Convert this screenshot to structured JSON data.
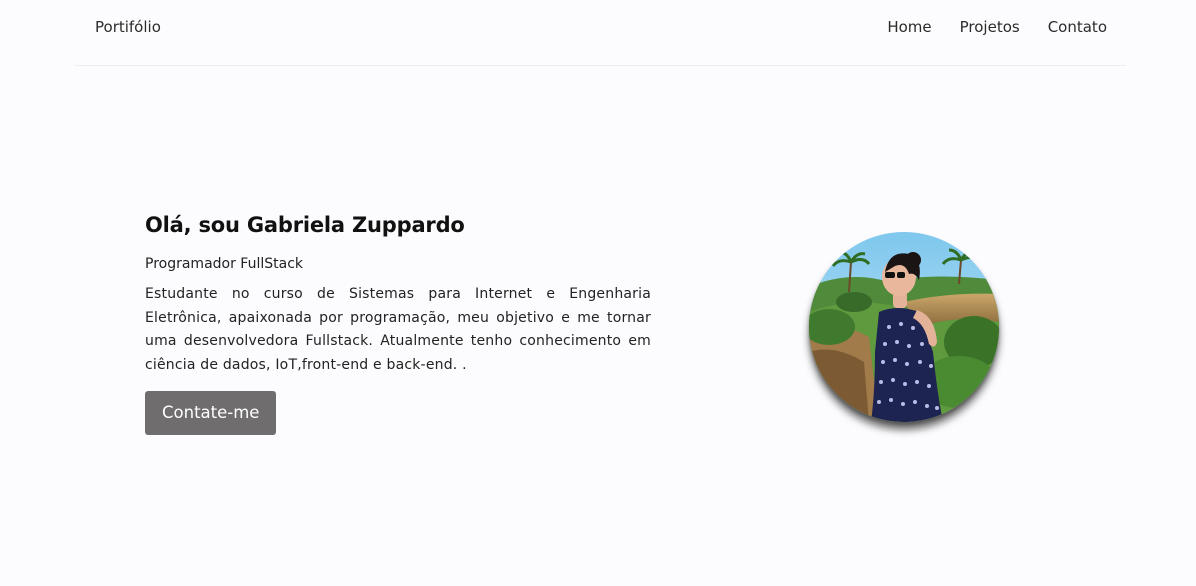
{
  "header": {
    "brand": "Portifólio",
    "nav": [
      {
        "label": "Home"
      },
      {
        "label": "Projetos"
      },
      {
        "label": "Contato"
      }
    ]
  },
  "hero": {
    "title": "Olá, sou Gabriela Zuppardo",
    "subtitle": "Programador FullStack",
    "description": "Estudante no curso de Sistemas para Internet e Engenharia Eletrônica, apaixonada por programação, meu objetivo e me tornar uma desenvolvedora Fullstack. Atualmente tenho conhecimento em ciência de dados, IoT,front-end e back-end. .",
    "button_label": "Contate-me"
  },
  "colors": {
    "background": "#fcfcfe",
    "button": "#6f6d6d",
    "text": "#1a1a1a"
  }
}
